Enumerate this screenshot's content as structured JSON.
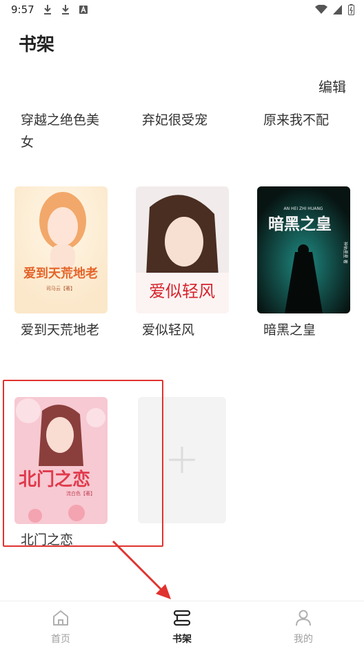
{
  "status_bar": {
    "time": "9:57"
  },
  "header": {
    "title": "书架",
    "edit_label": "编辑"
  },
  "text_only_books": [
    {
      "title": "穿越之绝色美女"
    },
    {
      "title": "弃妃很受宠"
    },
    {
      "title": "原来我不配"
    }
  ],
  "books": [
    {
      "title": "爱到天荒地老",
      "cover_title": "爱到天荒地老",
      "cover_author": "司马云【著】"
    },
    {
      "title": "爱似轻风",
      "cover_title": "爱似轻风"
    },
    {
      "title": "暗黑之皇",
      "cover_title": "暗黑之皇",
      "cover_pinyin": "AN HEI ZHI HUANG",
      "cover_author": "神佑星星 著"
    },
    {
      "title": "北门之恋",
      "cover_title": "北门之恋",
      "cover_author": "流白色【著】"
    }
  ],
  "add_tile": {
    "icon": "plus-icon"
  },
  "tabs": [
    {
      "label": "首页",
      "icon": "home-icon",
      "active": false
    },
    {
      "label": "书架",
      "icon": "bookshelf-icon",
      "active": true
    },
    {
      "label": "我的",
      "icon": "person-icon",
      "active": false
    }
  ],
  "annotation": {
    "highlight_color": "#e0332f"
  }
}
